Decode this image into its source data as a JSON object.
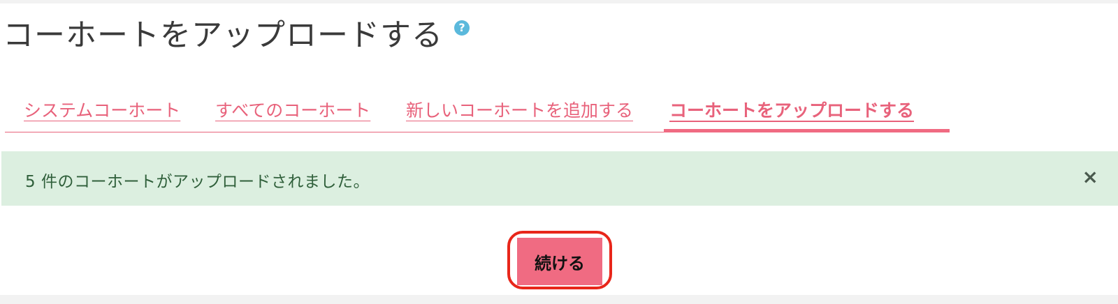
{
  "page": {
    "title": "コーホートをアップロードする",
    "help_icon": "question-icon",
    "help_glyph": "?"
  },
  "tabs": [
    {
      "label": "システムコーホート",
      "active": false
    },
    {
      "label": "すべてのコーホート",
      "active": false
    },
    {
      "label": "新しいコーホートを追加する",
      "active": false
    },
    {
      "label": "コーホートをアップロードする",
      "active": true
    }
  ],
  "alert": {
    "message": "5 件のコーホートがアップロードされました。",
    "close_glyph": "×",
    "close_icon": "close-icon"
  },
  "actions": {
    "continue_label": "続ける"
  },
  "colors": {
    "accent": "#f06b82",
    "link": "#e8627b",
    "success_bg": "#dcefe0",
    "success_text": "#2f5f3a",
    "highlight": "#e8261a"
  }
}
